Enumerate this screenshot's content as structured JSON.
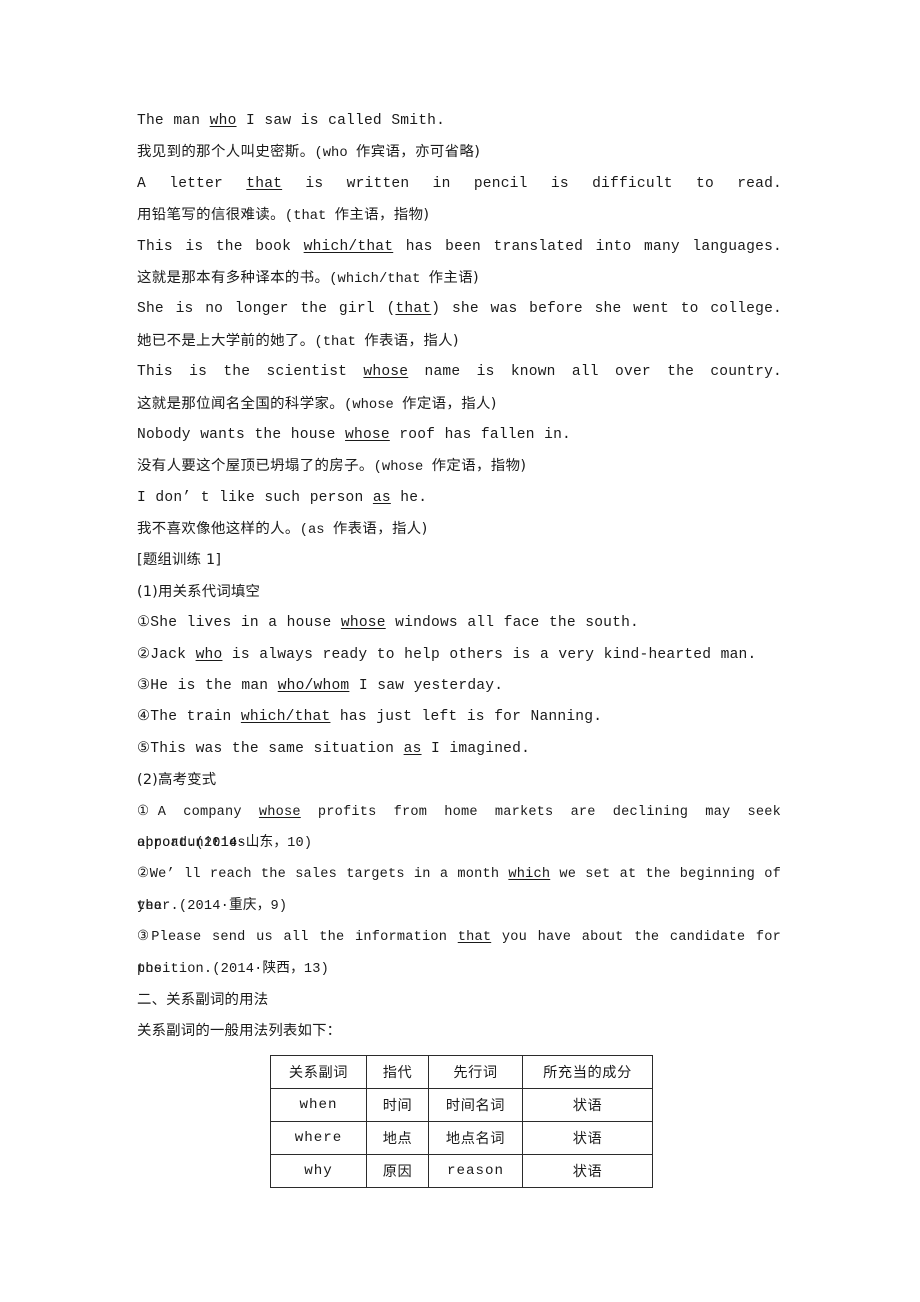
{
  "document": {
    "type": "grammar-worksheet",
    "language": "zh-CN + en",
    "background_color": "#ffffff",
    "text_color": "#1a1a1a"
  },
  "examples": [
    {
      "en": "The man <u>who</u> I saw is called Smith.",
      "zh": "我见到的那个人叫史密斯。(who 作宾语，亦可省略)"
    },
    {
      "en": "A letter <u>that</u> is written in pencil is difficult to read.",
      "zh": "用铅笔写的信很难读。(that 作主语，指物)"
    },
    {
      "en": "This is the book <u>which/that</u> has been translated into many languages.",
      "zh": "这就是那本有多种译本的书。(which/that 作主语)"
    },
    {
      "en": "She is no longer the girl (<u>that</u>) she was before she went to college.",
      "zh": "她已不是上大学前的她了。(that 作表语，指人)"
    },
    {
      "en": "This is the scientist <u>whose</u> name is known all over the country.",
      "zh": "这就是那位闻名全国的科学家。(whose 作定语，指人)"
    },
    {
      "en": "Nobody wants the house <u>whose</u> roof has fallen in.",
      "zh": "没有人要这个屋顶已坍塌了的房子。(whose 作定语，指物)"
    },
    {
      "en": "I don’ t like such person <u>as</u> he.",
      "zh": "我不喜欢像他这样的人。(as 作表语，指人)"
    }
  ],
  "exercise_block": {
    "title": "[题组训练 1]",
    "part1": {
      "label": "(1)用关系代词填空",
      "items": [
        "①She lives in a house <u>whose</u> windows all face the south.",
        "②Jack <u>who</u> is always ready to help others is a very kind-hearted man.",
        "③He is the man <u>who/whom</u> I saw yesterday.",
        "④The train <u>which/that</u> has just left is for Nanning.",
        "⑤This was the same situation <u>as</u> I imagined."
      ]
    },
    "part2": {
      "label": "(2)高考变式",
      "items": [
        {
          "line1": "①A company <u>whose</u> profits from home markets are declining may seek opportunities",
          "line2": "abroad.(2014·山东，10)"
        },
        {
          "line1": "②We’ ll reach the sales targets in a month <u>which</u> we set at the beginning of the",
          "line2": "year.(2014·重庆，9)"
        },
        {
          "line1": "③Please send us all the information <u>that</u> you have about the candidate for the",
          "line2": "position.(2014·陕西，13)"
        }
      ]
    }
  },
  "section": {
    "heading": "二、关系副词的用法",
    "intro": "关系副词的一般用法列表如下："
  },
  "table": {
    "headers": [
      "关系副词",
      "指代",
      "先行词",
      "所充当的成分"
    ],
    "rows": [
      {
        "adverb": "when",
        "refers": "时间",
        "antecedent": "时间名词",
        "function": "状语"
      },
      {
        "adverb": "where",
        "refers": "地点",
        "antecedent": "地点名词",
        "function": "状语"
      },
      {
        "adverb": "why",
        "refers": "原因",
        "antecedent": "reason",
        "function": "状语"
      }
    ]
  }
}
